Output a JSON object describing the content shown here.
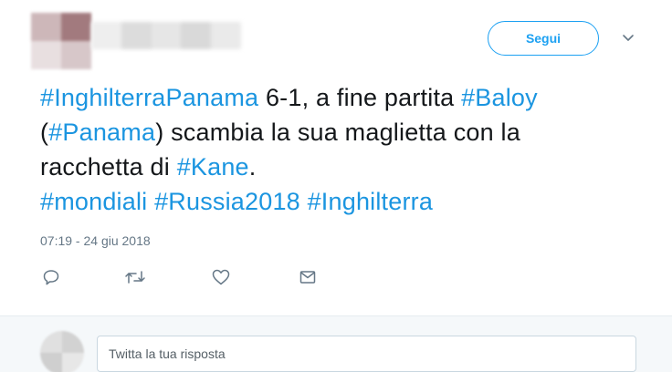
{
  "tweet": {
    "author": {
      "avatar_icon": "blurred-avatar",
      "name_redacted": true
    },
    "follow_label": "Segui",
    "menu_icon": "chevron-down-icon",
    "text_lines": [
      [
        {
          "type": "hashtag",
          "text": "#InghilterraPanama"
        },
        {
          "type": "text",
          "text": " 6-1, a fine partita "
        },
        {
          "type": "hashtag",
          "text": "#Baloy"
        }
      ],
      [
        {
          "type": "text",
          "text": "("
        },
        {
          "type": "hashtag",
          "text": "#Panama"
        },
        {
          "type": "text",
          "text": ") scambia la sua maglietta con la"
        }
      ],
      [
        {
          "type": "text",
          "text": "racchetta di "
        },
        {
          "type": "hashtag",
          "text": "#Kane"
        },
        {
          "type": "text",
          "text": "."
        }
      ],
      [
        {
          "type": "hashtag",
          "text": "#mondiali"
        },
        {
          "type": "text",
          "text": " "
        },
        {
          "type": "hashtag",
          "text": "#Russia2018"
        },
        {
          "type": "text",
          "text": " "
        },
        {
          "type": "hashtag",
          "text": "#Inghilterra"
        }
      ]
    ],
    "timestamp": "07:19 - 24 giu 2018",
    "actions": [
      {
        "name": "reply",
        "icon": "reply-icon"
      },
      {
        "name": "retweet",
        "icon": "retweet-icon"
      },
      {
        "name": "like",
        "icon": "heart-icon"
      },
      {
        "name": "direct-message",
        "icon": "envelope-icon"
      }
    ]
  },
  "reply": {
    "placeholder": "Twitta la tua risposta"
  },
  "colors": {
    "accent": "#1da1f2",
    "hashtag": "#1b95e0",
    "text": "#14171a",
    "muted": "#657786",
    "reply_bg": "#f5f8fa"
  }
}
